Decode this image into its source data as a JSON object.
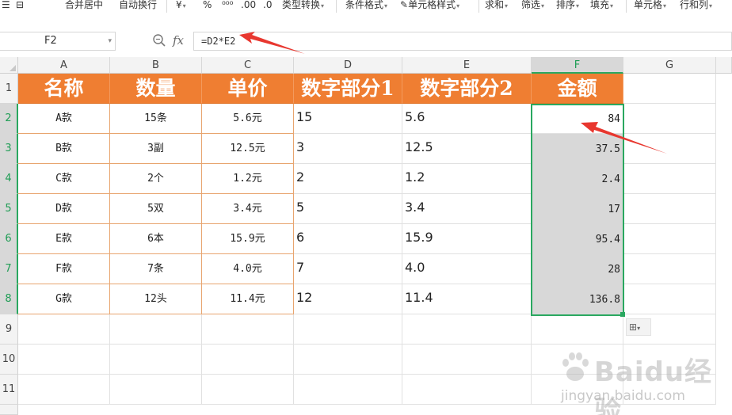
{
  "toolbar": {
    "items": [
      "合并居中",
      "自动换行",
      "¥",
      "%",
      "类型转换",
      "条件格式",
      "单元格样式",
      "求和",
      "筛选",
      "排序",
      "填充",
      "单元格",
      "行和列"
    ]
  },
  "formula_bar": {
    "name_box": "F2",
    "formula": "=D2*E2",
    "fx_label": "fx"
  },
  "columns": [
    "A",
    "B",
    "C",
    "D",
    "E",
    "F",
    "G"
  ],
  "rows": [
    "1",
    "2",
    "3",
    "4",
    "5",
    "6",
    "7",
    "8",
    "9",
    "10",
    "11"
  ],
  "table": {
    "headers": [
      "名称",
      "数量",
      "单价",
      "数字部分1",
      "数字部分2",
      "金额"
    ],
    "rows": [
      {
        "name": "A款",
        "qty": "15条",
        "price": "5.6元",
        "n1": "15",
        "n2": "5.6",
        "amount": "84"
      },
      {
        "name": "B款",
        "qty": "3副",
        "price": "12.5元",
        "n1": "3",
        "n2": "12.5",
        "amount": "37.5"
      },
      {
        "name": "C款",
        "qty": "2个",
        "price": "1.2元",
        "n1": "2",
        "n2": "1.2",
        "amount": "2.4"
      },
      {
        "name": "D款",
        "qty": "5双",
        "price": "3.4元",
        "n1": "5",
        "n2": "3.4",
        "amount": "17"
      },
      {
        "name": "E款",
        "qty": "6本",
        "price": "15.9元",
        "n1": "6",
        "n2": "15.9",
        "amount": "95.4"
      },
      {
        "name": "F款",
        "qty": "7条",
        "price": "4.0元",
        "n1": "7",
        "n2": "4.0",
        "amount": "28"
      },
      {
        "name": "G款",
        "qty": "12头",
        "price": "11.4元",
        "n1": "12",
        "n2": "11.4",
        "amount": "136.8"
      }
    ]
  },
  "watermark": {
    "brand": "Baidu经验",
    "url": "jingyan.baidu.com"
  },
  "colors": {
    "header_fill": "#ef7e32",
    "selection": "#2aa860",
    "arrow": "#e8372f"
  }
}
